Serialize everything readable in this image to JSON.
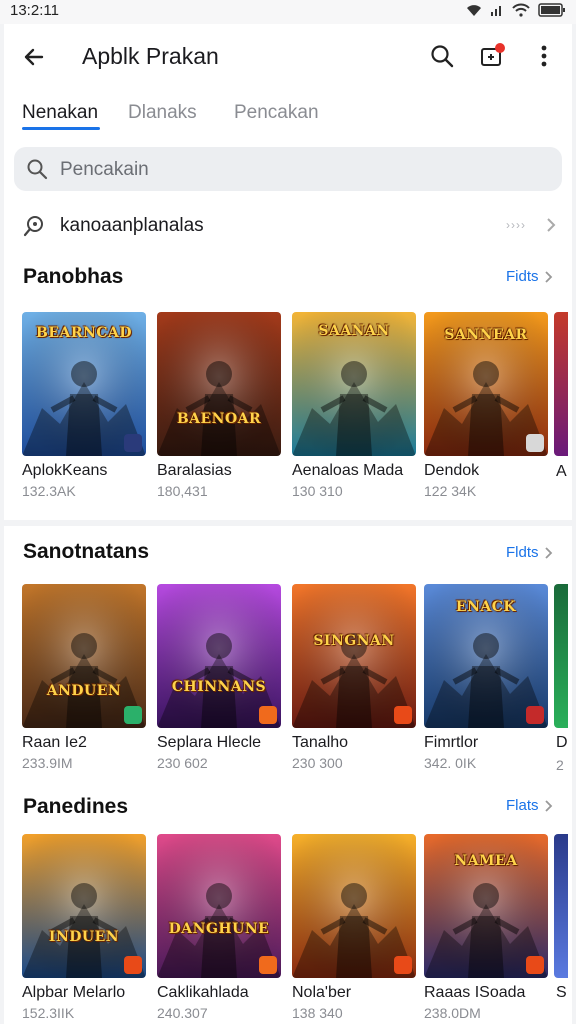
{
  "status": {
    "time": "13:2:11"
  },
  "app": {
    "title": "Apblk Prakan"
  },
  "tabs": [
    {
      "label": "Nenakan",
      "active": true
    },
    {
      "label": "Dlanaks",
      "active": false
    },
    {
      "label": "Pencakan",
      "active": false
    }
  ],
  "search": {
    "placeholder": "Pencakain"
  },
  "link_row": {
    "label": "kanoaanþlanalas",
    "more": "››››"
  },
  "sections": [
    {
      "title": "Panobhas",
      "more": "Fidts",
      "peek": {
        "letter": "A",
        "size": ""
      },
      "games": [
        {
          "name": "AplokKeans",
          "size": "132.3AK",
          "art": "BEARNCAD",
          "colors": [
            "#1e4c9a",
            "#6fb0e6"
          ],
          "badge": "#2a3a7a"
        },
        {
          "name": "Baralasias",
          "size": "180,431",
          "art": "BAENOAR",
          "colors": [
            "#3a1c12",
            "#a33a1a"
          ],
          "badge": ""
        },
        {
          "name": "Aenaloas Mada",
          "size": "130 310",
          "art": "SAANAN",
          "colors": [
            "#1a7a9a",
            "#f3b436"
          ],
          "badge": ""
        },
        {
          "name": "Dendok",
          "size": "122 34K",
          "art": "SANNEAR",
          "colors": [
            "#8a2a10",
            "#f39a1c"
          ],
          "badge": "#d8d8d8"
        }
      ]
    },
    {
      "title": "Sanotnatans",
      "more": "Fldts",
      "peek": {
        "letter": "D",
        "size": "2"
      },
      "games": [
        {
          "name": "Raan Ie2",
          "size": "233.9IM",
          "art": "ANDUEN",
          "colors": [
            "#4a2a18",
            "#c2762a"
          ],
          "badge": "#2bb06a"
        },
        {
          "name": "Seplara Hlecle",
          "size": "230 602",
          "art": "CHINNANS",
          "colors": [
            "#3a1460",
            "#b64ae0"
          ],
          "badge": "#f06a1c"
        },
        {
          "name": "Tanalho",
          "size": "230 300",
          "art": "SINGNAN",
          "colors": [
            "#6a1a12",
            "#f2762a"
          ],
          "badge": "#e84a18"
        },
        {
          "name": "Fimrtlor",
          "size": "342. 0IK",
          "art": "ENACK",
          "colors": [
            "#173a6a",
            "#5a8ad8"
          ],
          "badge": "#c42a2a"
        }
      ]
    },
    {
      "title": "Panedines",
      "more": "Flats",
      "peek": {
        "letter": "S",
        "size": ""
      },
      "games": [
        {
          "name": "Alpbar Melarlo",
          "size": "152.3IIK",
          "art": "INDUEN",
          "colors": [
            "#1a4a8a",
            "#f2a02a"
          ],
          "badge": "#e84a18"
        },
        {
          "name": "Caklikahlada",
          "size": "240.307",
          "art": "DANGHUNE",
          "colors": [
            "#4a1a5a",
            "#e04a8a"
          ],
          "badge": "#f06a1c"
        },
        {
          "name": "Nola'ber",
          "size": "138 340",
          "art": "",
          "colors": [
            "#8a2a10",
            "#f6b02a"
          ],
          "badge": "#e84a18"
        },
        {
          "name": "Raaas ISoada",
          "size": "238.0DM",
          "art": "NAMEA",
          "colors": [
            "#2a2a6a",
            "#e86a2a"
          ],
          "badge": "#e84a18"
        }
      ]
    }
  ]
}
